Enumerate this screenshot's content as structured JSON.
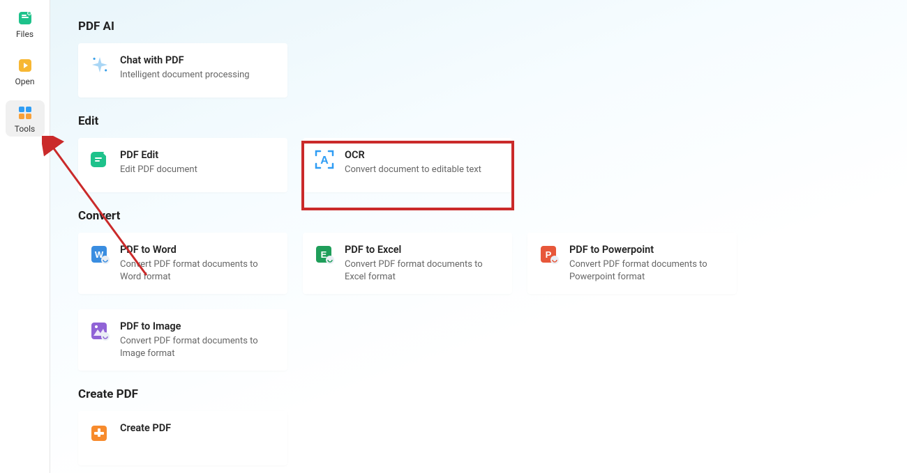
{
  "sidebar": {
    "items": [
      {
        "label": "Files",
        "icon": "files-icon"
      },
      {
        "label": "Open",
        "icon": "open-icon"
      },
      {
        "label": "Tools",
        "icon": "tools-icon"
      }
    ],
    "active_index": 2
  },
  "sections": {
    "pdf_ai": {
      "title": "PDF AI",
      "cards": [
        {
          "title": "Chat with PDF",
          "desc": "Intelligent document processing"
        }
      ]
    },
    "edit": {
      "title": "Edit",
      "cards": [
        {
          "title": "PDF Edit",
          "desc": "Edit PDF document"
        },
        {
          "title": "OCR",
          "desc": "Convert document to editable text"
        }
      ]
    },
    "convert": {
      "title": "Convert",
      "cards": [
        {
          "title": "PDF to Word",
          "desc": "Convert PDF format documents to Word format"
        },
        {
          "title": "PDF to Excel",
          "desc": "Convert PDF format documents to Excel format"
        },
        {
          "title": "PDF to Powerpoint",
          "desc": "Convert PDF format documents to Powerpoint format"
        },
        {
          "title": "PDF to Image",
          "desc": "Convert PDF format documents to Image format"
        }
      ]
    },
    "create": {
      "title": "Create PDF",
      "cards": [
        {
          "title": "Create PDF",
          "desc": ""
        }
      ]
    }
  },
  "annotations": {
    "highlight_target": "ocr-card",
    "arrow_color": "#ca2a2a"
  }
}
